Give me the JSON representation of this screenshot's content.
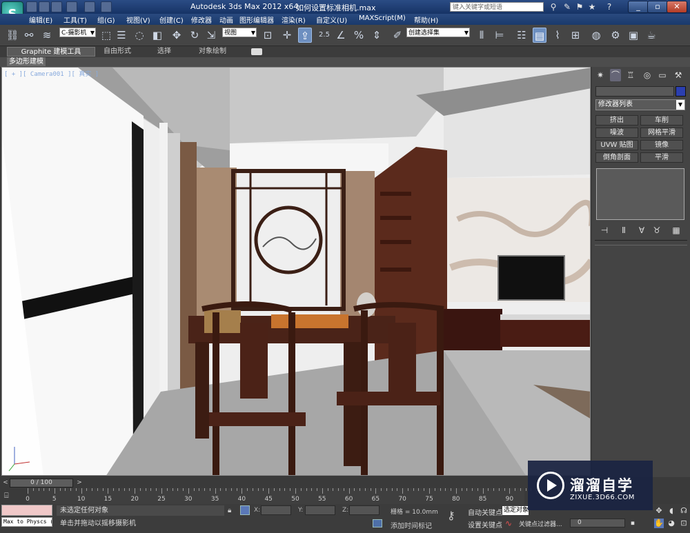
{
  "window": {
    "title": "Autodesk 3ds Max  2012 x64",
    "file": "如何设置标准相机.max",
    "search_placeholder": "键入关键字或短语"
  },
  "menu": [
    "编辑(E)",
    "工具(T)",
    "组(G)",
    "视图(V)",
    "创建(C)",
    "修改器",
    "动画",
    "图形编辑器",
    "渲染(R)",
    "自定义(U)",
    "MAXScript(M)",
    "帮助(H)"
  ],
  "toolbar": {
    "selection_filter": "C-摄影机",
    "ref_coord": "视图",
    "snap_label": "2.5",
    "named_selection": "创建选择集"
  },
  "ribbon": {
    "tabs": [
      "Graphite 建模工具",
      "自由形式",
      "选择",
      "对象绘制"
    ],
    "sub_label": "多边形建模"
  },
  "viewport": {
    "label": "[ + ][ Camera001 ][ 真实 ]"
  },
  "command_panel": {
    "modifier_list": "修改器列表",
    "buttons": [
      "挤出",
      "车削",
      "噪波",
      "网格平滑",
      "UVW 贴图",
      "镜像",
      "倒角剖面",
      "平滑"
    ]
  },
  "timeline": {
    "slider": "0 / 100",
    "ticks": [
      "0",
      "5",
      "10",
      "15",
      "20",
      "25",
      "30",
      "35",
      "40",
      "45",
      "50",
      "55",
      "60",
      "65",
      "70",
      "75",
      "80",
      "85",
      "90"
    ]
  },
  "status": {
    "maxscript_text": "Max to Physcs (",
    "selection": "未选定任何对象",
    "prompt": "单击并拖动以摇移摄影机",
    "x_label": "X:",
    "y_label": "Y:",
    "z_label": "Z:",
    "grid": "栅格 = 10.0mm",
    "add_time_tag": "添加时间标记",
    "auto_key": "自动关键点",
    "set_key": "设置关键点",
    "selected_combo": "选定对象",
    "key_filters": "关键点过滤器...",
    "frame": "0"
  },
  "watermark": {
    "title": "溜溜自学",
    "url": "ZIXUE.3D66.COM"
  }
}
